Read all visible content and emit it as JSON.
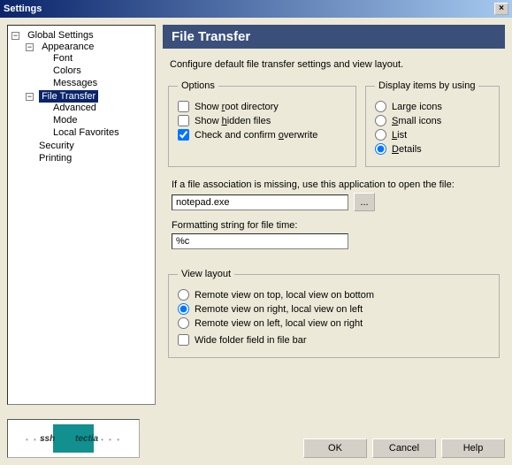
{
  "titlebar": {
    "title": "Settings",
    "close": "×"
  },
  "tree": {
    "root": "Global Settings",
    "appearance": {
      "label": "Appearance",
      "children": [
        "Font",
        "Colors",
        "Messages"
      ]
    },
    "filetransfer": {
      "label": "File Transfer",
      "children": [
        "Advanced",
        "Mode",
        "Local Favorites"
      ]
    },
    "security": "Security",
    "printing": "Printing"
  },
  "main": {
    "heading": "File Transfer",
    "description": "Configure default file transfer settings and view layout.",
    "options": {
      "legend": "Options",
      "show_root": "Show root directory",
      "show_hidden": "Show hidden files",
      "confirm_overwrite": "Check and confirm overwrite"
    },
    "display": {
      "legend": "Display items by using",
      "large": "Large icons",
      "small": "Small icons",
      "list": "List",
      "details": "Details"
    },
    "assoc": {
      "label": "If a file association is missing, use this application to open the file:",
      "value": "notepad.exe",
      "browse": "..."
    },
    "fmt": {
      "label": "Formatting string for file time:",
      "value": "%c"
    },
    "viewlayout": {
      "legend": "View layout",
      "opt1": "Remote view on top, local view on bottom",
      "opt2": "Remote view on right, local view on left",
      "opt3": "Remote view on left, local view on right",
      "wide": "Wide folder field in file bar"
    }
  },
  "logo": {
    "ssh": "ssh",
    "tectia": "tectia"
  },
  "buttons": {
    "ok": "OK",
    "cancel": "Cancel",
    "help": "Help"
  }
}
